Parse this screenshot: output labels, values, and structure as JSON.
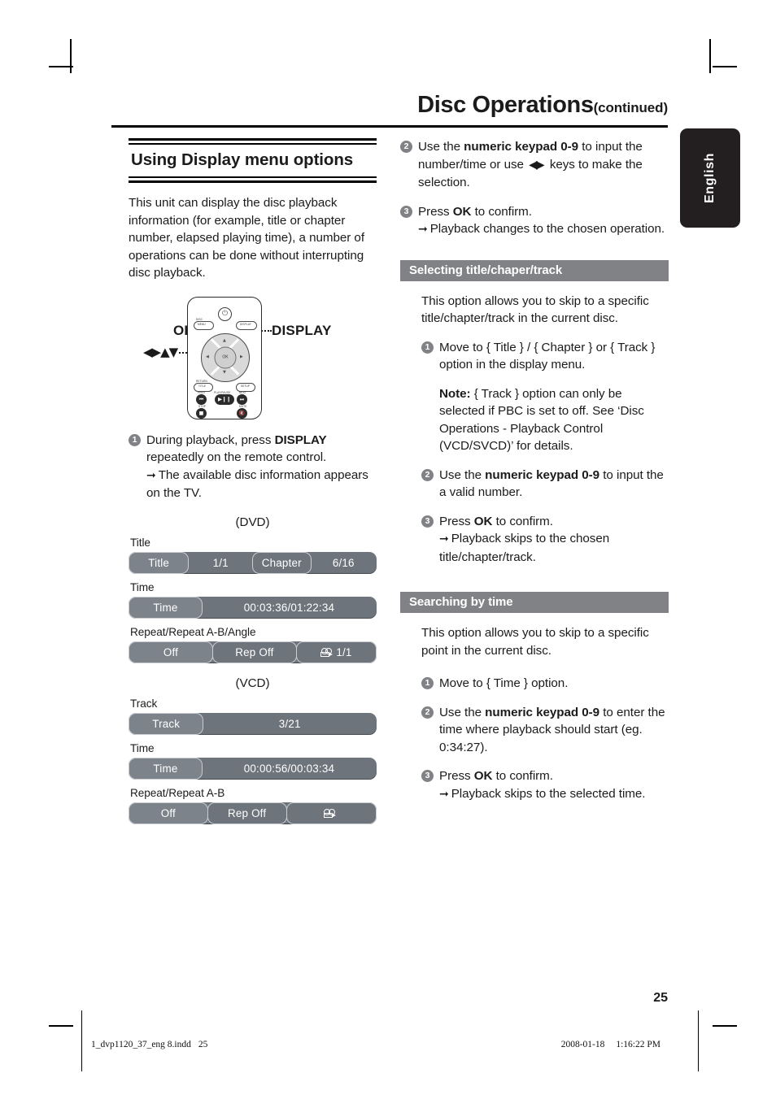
{
  "header": {
    "title": "Disc Operations",
    "continued": "(continued)"
  },
  "language_tab": {
    "label": "English"
  },
  "left_column": {
    "section_title": "Using Display menu options",
    "intro": "This unit can display the disc playback information (for example, title or chapter number, elapsed playing time), a number of operations can be done without interrupting disc playback.",
    "remote": {
      "label_ok": "OK",
      "label_arrows": "◀▶▲▼",
      "label_display": "DISPLAY",
      "buttons": {
        "disc_menu": "DISC MENU",
        "display": "DISPLAY",
        "return_title": "RETURN TITLE",
        "setup": "SETUP",
        "prev": "PREV",
        "play_pause": "PLAY/PAUSE",
        "next": "NEXT",
        "stop": "STOP",
        "mute": "MUTE",
        "ok": "OK"
      }
    },
    "step1": {
      "num": "1",
      "text_before": "During playback, press ",
      "bold": "DISPLAY",
      "text_after": " repeatedly on the remote control.",
      "result": "The available disc information appears on the TV."
    },
    "osd": [
      {
        "type_label": "(DVD)",
        "rows": [
          {
            "caption": "Title",
            "segments": [
              {
                "text": "Title",
                "style": "lighter",
                "flex": 80
              },
              {
                "text": "1/1",
                "style": "plain",
                "flex": 88
              },
              {
                "text": "Chapter",
                "style": "normal",
                "flex": 78
              },
              {
                "text": "6/16",
                "style": "plain",
                "flex": 90
              }
            ]
          },
          {
            "caption": "Time",
            "segments": [
              {
                "text": "Time",
                "style": "lighter",
                "flex": 86
              },
              {
                "text": "00:03:36/01:22:34",
                "style": "plain",
                "flex": 208
              }
            ]
          },
          {
            "caption": "Repeat/Repeat A-B/Angle",
            "segments": [
              {
                "text": "Off",
                "style": "lighter",
                "flex": 84
              },
              {
                "text": "Rep Off",
                "style": "normal",
                "flex": 84
              },
              {
                "text": "1/1",
                "style": "normal",
                "flex": 80,
                "icon": "camera-angle-icon"
              }
            ]
          }
        ]
      },
      {
        "type_label": "(VCD)",
        "rows": [
          {
            "caption": "Track",
            "segments": [
              {
                "text": "Track",
                "style": "lighter",
                "flex": 88
              },
              {
                "text": "3/21",
                "style": "plain",
                "flex": 208
              }
            ]
          },
          {
            "caption": "Time",
            "segments": [
              {
                "text": "Time",
                "style": "lighter",
                "flex": 86
              },
              {
                "text": "00:00:56/00:03:34",
                "style": "plain",
                "flex": 208
              }
            ]
          },
          {
            "caption": "Repeat/Repeat A-B",
            "segments": [
              {
                "text": "Off",
                "style": "lighter",
                "flex": 84
              },
              {
                "text": "Rep Off",
                "style": "normal",
                "flex": 84
              },
              {
                "text": "",
                "style": "normal",
                "flex": 96,
                "icon": "camera-angle-icon"
              }
            ]
          }
        ]
      }
    ]
  },
  "right_column": {
    "step2": {
      "num": "2",
      "a": "Use the ",
      "bold": "numeric keypad 0-9",
      "b": " to input the number/time or use ",
      "arrows": "◀▶",
      "c": " keys to make the selection."
    },
    "step3": {
      "num": "3",
      "a": "Press ",
      "bold": "OK",
      "b": " to confirm.",
      "result": "Playback changes to the chosen operation."
    },
    "section_a": {
      "heading": "Selecting title/chaper/track",
      "intro": "This option allows you to skip to a specific title/chapter/track in the current disc.",
      "step1": {
        "num": "1",
        "text": "Move to { Title } / { Chapter } or { Track } option in the display menu."
      },
      "note": {
        "label": "Note:",
        "text": " { Track } option can only be selected if PBC is set to off. See ‘Disc Operations - Playback Control (VCD/SVCD)’ for details."
      },
      "step2": {
        "num": "2",
        "a": "Use the ",
        "bold": "numeric keypad 0-9",
        "b": " to input the a valid number."
      },
      "step3": {
        "num": "3",
        "a": "Press ",
        "bold": "OK",
        "b": " to confirm.",
        "result": "Playback skips to the chosen title/chapter/track."
      }
    },
    "section_b": {
      "heading": "Searching by time",
      "intro": "This option allows you to skip to a specific point in the current disc.",
      "step1": {
        "num": "1",
        "text": "Move to { Time } option."
      },
      "step2": {
        "num": "2",
        "a": "Use the ",
        "bold": "numeric keypad 0-9",
        "b": " to enter the time where playback should start (eg. 0:34:27)."
      },
      "step3": {
        "num": "3",
        "a": "Press ",
        "bold": "OK",
        "b": " to confirm.",
        "result": "Playback skips to the selected time."
      }
    }
  },
  "page_number": "25",
  "footer": {
    "file": "1_dvp1120_37_eng 8.indd",
    "page": "25",
    "date": "2008-01-18",
    "time": "1:16:22 PM"
  },
  "colors": {
    "osd_bar": "#6e747c",
    "grey_header": "#808285",
    "tab_black": "#231f20"
  }
}
